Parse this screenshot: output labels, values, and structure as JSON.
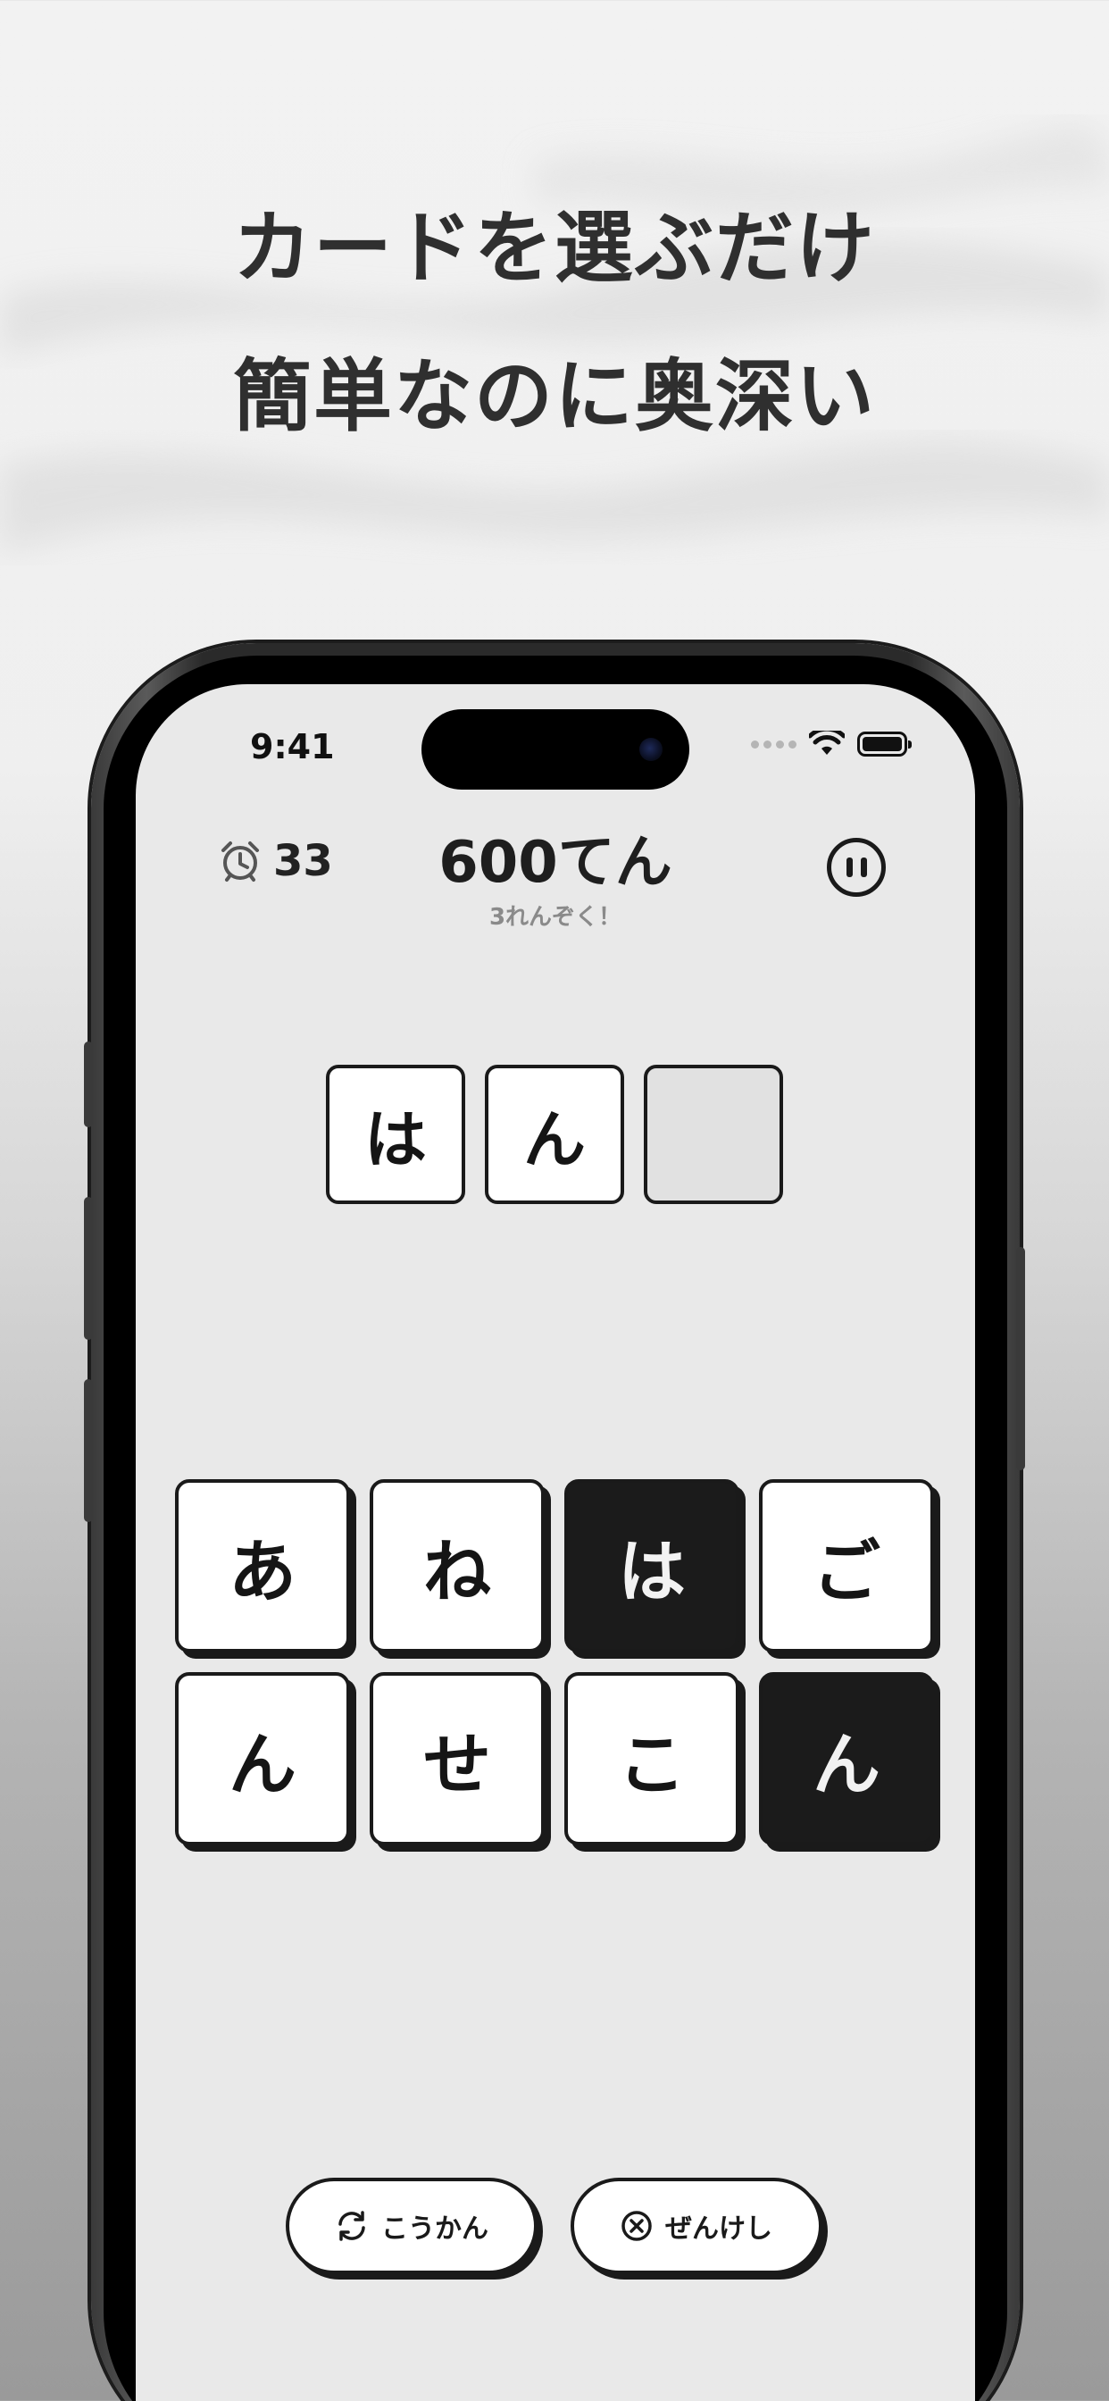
{
  "headline": {
    "line1": "カードを選ぶだけ",
    "line2": "簡単なのに奥深い"
  },
  "status_bar": {
    "time": "9:41"
  },
  "game": {
    "timer_icon": "alarm-clock-icon",
    "timer_value": "33",
    "score": "600てん",
    "combo": "3れんぞく！",
    "pause_icon": "pause-icon",
    "slots": [
      "は",
      "ん",
      ""
    ],
    "cards": [
      {
        "char": "あ",
        "selected": false
      },
      {
        "char": "ね",
        "selected": false
      },
      {
        "char": "は",
        "selected": true
      },
      {
        "char": "ご",
        "selected": false
      },
      {
        "char": "ん",
        "selected": false
      },
      {
        "char": "せ",
        "selected": false
      },
      {
        "char": "こ",
        "selected": false
      },
      {
        "char": "ん",
        "selected": true
      }
    ],
    "swap_label": "こうかん",
    "swap_icon": "refresh-icon",
    "clear_label": "ぜんけし",
    "clear_icon": "close-circle-icon"
  }
}
